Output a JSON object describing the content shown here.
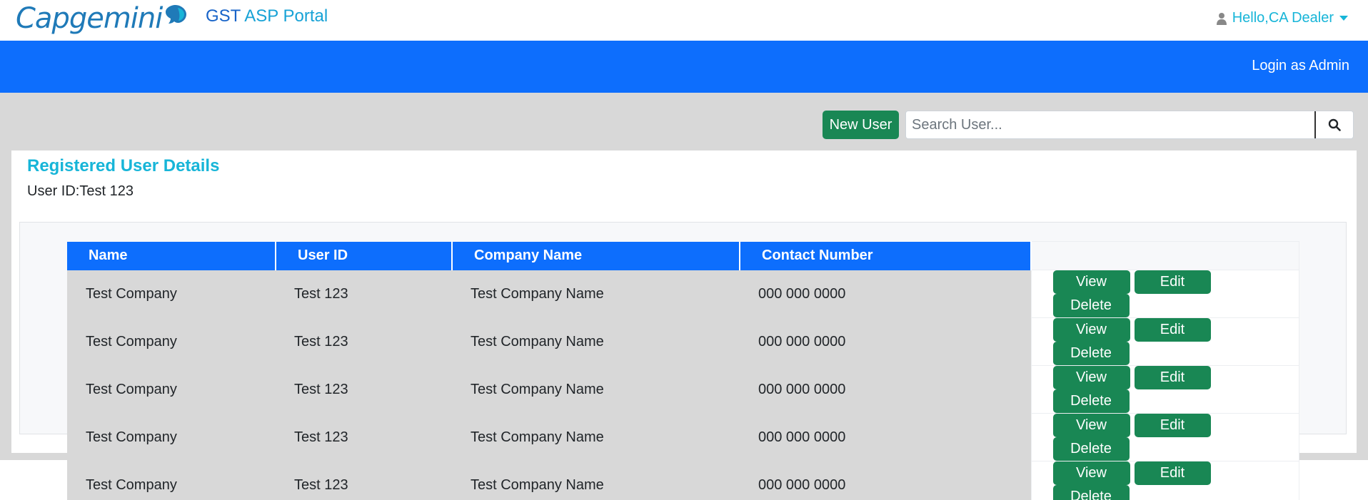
{
  "header": {
    "logo_text": "Capgemini",
    "portal_title_gst": "GST",
    "portal_title_asp": "ASP Portal",
    "user_greeting": "Hello,CA Dealer"
  },
  "nav": {
    "admin_link": "Login as Admin"
  },
  "toolbar": {
    "new_user_label": "New User",
    "search_placeholder": "Search User..."
  },
  "details": {
    "title": "Registered User Details",
    "user_id_text": "User ID:Test 123"
  },
  "table": {
    "columns": [
      "Name",
      "User ID",
      "Company Name",
      "Contact Number"
    ],
    "action_labels": {
      "view": "View",
      "edit": "Edit",
      "delete": "Delete"
    },
    "rows": [
      {
        "name": "Test Company",
        "user_id": "Test 123",
        "company": "Test Company Name",
        "contact": "000 000 0000"
      },
      {
        "name": "Test Company",
        "user_id": "Test 123",
        "company": "Test Company Name",
        "contact": "000 000 0000"
      },
      {
        "name": "Test Company",
        "user_id": "Test 123",
        "company": "Test Company Name",
        "contact": "000 000 0000"
      },
      {
        "name": "Test Company",
        "user_id": "Test 123",
        "company": "Test Company Name",
        "contact": "000 000 0000"
      },
      {
        "name": "Test Company",
        "user_id": "Test 123",
        "company": "Test Company Name",
        "contact": "000 000 0000"
      }
    ]
  },
  "colors": {
    "primary_blue": "#0d6efd",
    "success_green": "#198754",
    "accent_cyan": "#17b5d8",
    "background_grey": "#d8d8d8"
  },
  "icons": {
    "user": "user-icon",
    "search": "search-icon",
    "dropdown": "caret-down-icon",
    "logo_mark": "spade-logo-icon"
  }
}
